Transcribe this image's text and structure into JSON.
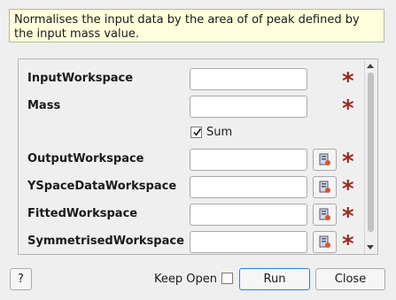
{
  "description": "Normalises the input data by the area of of peak defined by the input mass value.",
  "properties": [
    {
      "label": "InputWorkspace",
      "value": "",
      "required": true,
      "browse": false
    },
    {
      "label": "Mass",
      "value": "",
      "required": true,
      "browse": false
    },
    {
      "label": "OutputWorkspace",
      "value": "",
      "required": true,
      "browse": true
    },
    {
      "label": "YSpaceDataWorkspace",
      "value": "",
      "required": true,
      "browse": true
    },
    {
      "label": "FittedWorkspace",
      "value": "",
      "required": true,
      "browse": true
    },
    {
      "label": "SymmetrisedWorkspace",
      "value": "",
      "required": true,
      "browse": true
    }
  ],
  "sum_checkbox": {
    "label": "Sum",
    "checked": true
  },
  "required_marker": "*",
  "buttons": {
    "help": "?",
    "keep_open": "Keep Open",
    "run": "Run",
    "close": "Close"
  },
  "keep_open_checked": false,
  "colors": {
    "required_star": "#9c2a1f",
    "description_bg": "#ffffdc",
    "run_border": "#3d7ec5"
  }
}
